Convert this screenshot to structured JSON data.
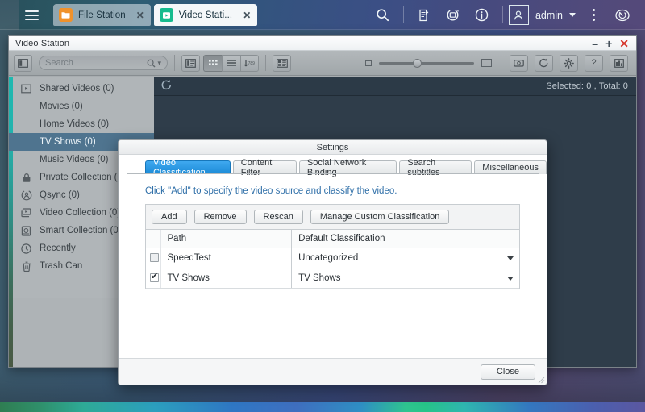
{
  "taskbar": {
    "menu_icon": "hamburger-menu-icon",
    "tabs": [
      {
        "label": "File Station",
        "icon": "folder-icon",
        "close": "✕",
        "active": false
      },
      {
        "label": "Video Stati...",
        "icon": "video-icon",
        "close": "✕",
        "active": true
      }
    ],
    "icons": {
      "search": "search-icon",
      "notes": "notes-icon",
      "sync": "sync-icon",
      "info": "info-icon",
      "user": "user-avatar-icon",
      "kebab": "more-options-icon",
      "dashboard": "dashboard-icon"
    },
    "user_name": "admin"
  },
  "window": {
    "title": "Video Station",
    "controls": {
      "minimize": "–",
      "maximize": "+",
      "close": "✕"
    }
  },
  "toolbar": {
    "sidebar_toggle": "sidebar-toggle-icon",
    "search_placeholder": "Search",
    "search_value": "",
    "search_icon": "search-icon",
    "search_caret": "▾",
    "view_list_icon": "list-view-icon",
    "view_grid_icon": "grid-view-icon",
    "view_detail_icon": "detail-view-icon",
    "view_sort_icon": "sort-icon",
    "view_card_icon": "card-view-icon",
    "zoom_small_icon": "zoom-small-icon",
    "zoom_large_icon": "zoom-large-icon",
    "zoom_value": "35",
    "tv_icon": "tv-output-icon",
    "refresh_icon": "refresh-icon",
    "settings_icon": "gear-icon",
    "help_icon": "?",
    "panel_icon": "panel-icon"
  },
  "sidebar": {
    "items": [
      {
        "label": "Shared Videos (0)",
        "icon": "shared-videos-icon",
        "selected": false,
        "indent": false
      },
      {
        "label": "Movies (0)",
        "icon": "",
        "selected": false,
        "indent": true
      },
      {
        "label": "Home Videos (0)",
        "icon": "",
        "selected": false,
        "indent": true
      },
      {
        "label": "TV Shows (0)",
        "icon": "",
        "selected": true,
        "indent": true
      },
      {
        "label": "Music Videos (0)",
        "icon": "",
        "selected": false,
        "indent": true
      },
      {
        "label": "Private Collection (0)",
        "icon": "lock-icon",
        "selected": false,
        "indent": false
      },
      {
        "label": "Qsync (0)",
        "icon": "qsync-icon",
        "selected": false,
        "indent": false
      },
      {
        "label": "Video Collection (0)",
        "icon": "video-collection-icon",
        "selected": false,
        "indent": false
      },
      {
        "label": "Smart Collection (0)",
        "icon": "smart-collection-icon",
        "selected": false,
        "indent": false
      },
      {
        "label": "Recently",
        "icon": "clock-icon",
        "selected": false,
        "indent": false
      },
      {
        "label": "Trash Can",
        "icon": "trash-icon",
        "selected": false,
        "indent": false
      }
    ]
  },
  "content": {
    "refresh_icon": "refresh-arrow-icon",
    "status": "Selected: 0  ,  Total: 0"
  },
  "dialog": {
    "title": "Settings",
    "tabs": [
      {
        "label": "Video Classification",
        "active": true
      },
      {
        "label": "Content Filter",
        "active": false
      },
      {
        "label": "Social Network Binding",
        "active": false
      },
      {
        "label": "Search subtitles",
        "active": false
      },
      {
        "label": "Miscellaneous",
        "active": false
      }
    ],
    "hint": "Click \"Add\" to specify the video source and classify the video.",
    "buttons": [
      {
        "label": "Add",
        "name": "add-button"
      },
      {
        "label": "Remove",
        "name": "remove-button"
      },
      {
        "label": "Rescan",
        "name": "rescan-button"
      },
      {
        "label": "Manage Custom Classification",
        "name": "manage-custom-classification-button"
      }
    ],
    "table": {
      "columns": [
        "",
        "Path",
        "Default Classification"
      ],
      "rows": [
        {
          "checked": false,
          "path": "SpeedTest",
          "classification": "Uncategorized"
        },
        {
          "checked": true,
          "path": "TV Shows",
          "classification": "TV Shows"
        }
      ]
    },
    "close_label": "Close"
  },
  "colors": {
    "accent_blue": "#1b8ad6",
    "selection_blue": "#4f748f",
    "hint_blue": "#2f6fa8",
    "close_red": "#d6352b",
    "file_station_orange": "#f0922b",
    "video_station_green": "#16bb8e",
    "strip_teal": "#1fb9b0"
  }
}
